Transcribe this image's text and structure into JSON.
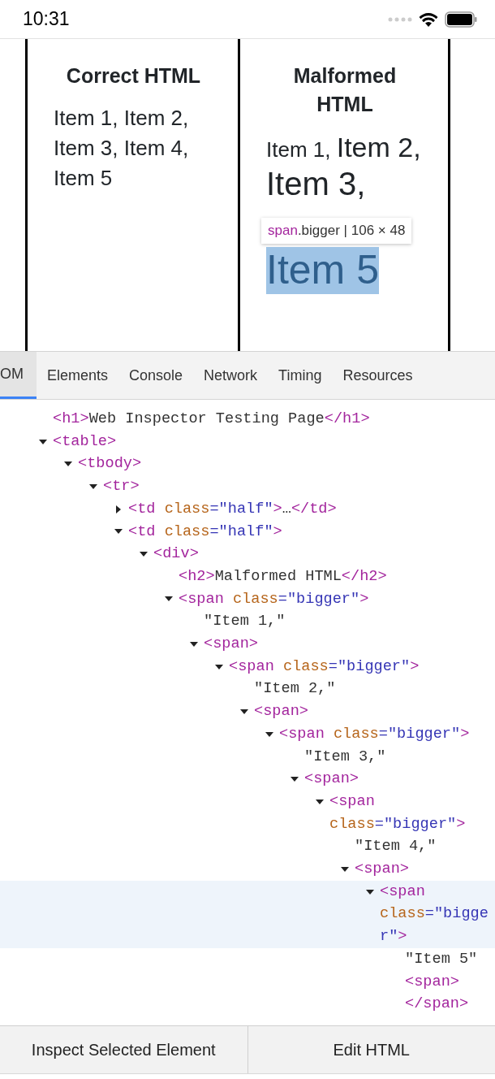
{
  "status_bar": {
    "time": "10:31"
  },
  "preview": {
    "columns": [
      {
        "heading": "Correct HTML",
        "items": [
          {
            "text": "Item 1,",
            "selected": false
          },
          {
            "text": "Item 2,",
            "selected": false
          },
          {
            "text": "Item 3,",
            "selected": false
          },
          {
            "text": "Item 4,",
            "selected": false
          },
          {
            "text": "Item 5",
            "selected": false
          }
        ],
        "kind": "flat"
      },
      {
        "heading": "Malformed HTML",
        "items": [
          {
            "text": "Item 1,",
            "selected": false
          },
          {
            "text": "Item 2,",
            "selected": false
          },
          {
            "text": "Item 3,",
            "selected": false
          },
          {
            "text": "Item 5",
            "selected": true
          }
        ],
        "kind": "nested"
      }
    ],
    "tooltip": {
      "tag": "span",
      "rest": ".bigger | 106 × 48"
    }
  },
  "tabs": [
    {
      "label": "OM",
      "selected": true
    },
    {
      "label": "Elements",
      "selected": false
    },
    {
      "label": "Console",
      "selected": false
    },
    {
      "label": "Network",
      "selected": false
    },
    {
      "label": "Timing",
      "selected": false
    },
    {
      "label": "Resources",
      "selected": false
    }
  ],
  "dom_tree": [
    {
      "selected": false,
      "lines": [
        [
          {
            "kind": "tag",
            "text": "<h1>"
          },
          {
            "kind": "text",
            "text": "Web Inspector Testing Page"
          },
          {
            "kind": "tag",
            "text": "</h1>"
          }
        ]
      ]
    },
    {
      "selected": false,
      "expanded": true,
      "lines": [
        [
          {
            "kind": "tag",
            "text": "<table>"
          }
        ]
      ],
      "children": [
        {
          "selected": false,
          "expanded": true,
          "lines": [
            [
              {
                "kind": "tag",
                "text": "<tbody>"
              }
            ]
          ],
          "children": [
            {
              "selected": false,
              "expanded": true,
              "lines": [
                [
                  {
                    "kind": "tag",
                    "text": "<tr>"
                  }
                ]
              ],
              "children": [
                {
                  "selected": false,
                  "expanded": false,
                  "lines": [
                    [
                      {
                        "kind": "tag",
                        "text": "<td"
                      },
                      {
                        "kind": "attr",
                        "text": " class"
                      },
                      {
                        "kind": "value",
                        "text": "=\"half\""
                      },
                      {
                        "kind": "tag",
                        "text": ">"
                      },
                      {
                        "kind": "text",
                        "text": "…"
                      },
                      {
                        "kind": "tag",
                        "text": "</td>"
                      }
                    ]
                  ]
                },
                {
                  "selected": false,
                  "expanded": true,
                  "lines": [
                    [
                      {
                        "kind": "tag",
                        "text": "<td"
                      },
                      {
                        "kind": "attr",
                        "text": " class"
                      },
                      {
                        "kind": "value",
                        "text": "=\"half\""
                      },
                      {
                        "kind": "tag",
                        "text": ">"
                      }
                    ]
                  ],
                  "children": [
                    {
                      "selected": false,
                      "expanded": true,
                      "lines": [
                        [
                          {
                            "kind": "tag",
                            "text": "<div>"
                          }
                        ]
                      ],
                      "children": [
                        {
                          "selected": false,
                          "lines": [
                            [
                              {
                                "kind": "tag",
                                "text": "<h2>"
                              },
                              {
                                "kind": "text",
                                "text": "Malformed HTML"
                              },
                              {
                                "kind": "tag",
                                "text": "</h2>"
                              }
                            ]
                          ]
                        },
                        {
                          "selected": false,
                          "expanded": true,
                          "lines": [
                            [
                              {
                                "kind": "tag",
                                "text": "<span"
                              },
                              {
                                "kind": "attr",
                                "text": " class"
                              },
                              {
                                "kind": "value",
                                "text": "=\"bigger\""
                              },
                              {
                                "kind": "tag",
                                "text": ">"
                              }
                            ]
                          ],
                          "children": [
                            {
                              "selected": false,
                              "lines": [
                                [
                                  {
                                    "kind": "text",
                                    "text": "\"Item 1,\""
                                  }
                                ]
                              ]
                            },
                            {
                              "selected": false,
                              "expanded": true,
                              "lines": [
                                [
                                  {
                                    "kind": "tag",
                                    "text": "<span>"
                                  }
                                ]
                              ],
                              "children": [
                                {
                                  "selected": false,
                                  "expanded": true,
                                  "lines": [
                                    [
                                      {
                                        "kind": "tag",
                                        "text": "<span"
                                      },
                                      {
                                        "kind": "attr",
                                        "text": " class"
                                      },
                                      {
                                        "kind": "value",
                                        "text": "=\"bigger\""
                                      },
                                      {
                                        "kind": "tag",
                                        "text": ">"
                                      }
                                    ]
                                  ],
                                  "children": [
                                    {
                                      "selected": false,
                                      "lines": [
                                        [
                                          {
                                            "kind": "text",
                                            "text": "\"Item 2,\""
                                          }
                                        ]
                                      ]
                                    },
                                    {
                                      "selected": false,
                                      "expanded": true,
                                      "lines": [
                                        [
                                          {
                                            "kind": "tag",
                                            "text": "<span>"
                                          }
                                        ]
                                      ],
                                      "children": [
                                        {
                                          "selected": false,
                                          "expanded": true,
                                          "lines": [
                                            [
                                              {
                                                "kind": "tag",
                                                "text": "<span"
                                              },
                                              {
                                                "kind": "attr",
                                                "text": " class"
                                              },
                                              {
                                                "kind": "value",
                                                "text": "=\"bigger\""
                                              },
                                              {
                                                "kind": "tag",
                                                "text": ">"
                                              }
                                            ]
                                          ],
                                          "children": [
                                            {
                                              "selected": false,
                                              "lines": [
                                                [
                                                  {
                                                    "kind": "text",
                                                    "text": "\"Item 3,\""
                                                  }
                                                ]
                                              ]
                                            },
                                            {
                                              "selected": false,
                                              "expanded": true,
                                              "lines": [
                                                [
                                                  {
                                                    "kind": "tag",
                                                    "text": "<span>"
                                                  }
                                                ]
                                              ],
                                              "children": [
                                                {
                                                  "selected": false,
                                                  "expanded": true,
                                                  "lines": [
                                                    [
                                                      {
                                                        "kind": "tag",
                                                        "text": "<span"
                                                      }
                                                    ],
                                                    [
                                                      {
                                                        "kind": "attr",
                                                        "text": "class"
                                                      },
                                                      {
                                                        "kind": "value",
                                                        "text": "=\"bigger\""
                                                      },
                                                      {
                                                        "kind": "tag",
                                                        "text": ">"
                                                      }
                                                    ]
                                                  ],
                                                  "children": [
                                                    {
                                                      "selected": false,
                                                      "lines": [
                                                        [
                                                          {
                                                            "kind": "text",
                                                            "text": "\"Item 4,\""
                                                          }
                                                        ]
                                                      ]
                                                    },
                                                    {
                                                      "selected": false,
                                                      "expanded": true,
                                                      "lines": [
                                                        [
                                                          {
                                                            "kind": "tag",
                                                            "text": "<span>"
                                                          }
                                                        ]
                                                      ],
                                                      "children": [
                                                        {
                                                          "selected": true,
                                                          "expanded": true,
                                                          "lines": [
                                                            [
                                                              {
                                                                "kind": "tag",
                                                                "text": "<span"
                                                              }
                                                            ],
                                                            [
                                                              {
                                                                "kind": "attr",
                                                                "text": "class"
                                                              },
                                                              {
                                                                "kind": "value",
                                                                "text": "=\"bigge"
                                                              }
                                                            ],
                                                            [
                                                              {
                                                                "kind": "value",
                                                                "text": "r\""
                                                              },
                                                              {
                                                                "kind": "tag",
                                                                "text": ">"
                                                              }
                                                            ]
                                                          ],
                                                          "children": [
                                                            {
                                                              "selected": false,
                                                              "lines": [
                                                                [
                                                                  {
                                                                    "kind": "text",
                                                                    "text": "\"Item 5\""
                                                                  }
                                                                ]
                                                              ]
                                                            },
                                                            {
                                                              "selected": false,
                                                              "lines": [
                                                                [
                                                                  {
                                                                    "kind": "tag",
                                                                    "text": "<span>"
                                                                  }
                                                                ],
                                                                [
                                                                  {
                                                                    "kind": "tag",
                                                                    "text": "</span>"
                                                                  }
                                                                ]
                                                              ]
                                                            }
                                                          ]
                                                        }
                                                      ]
                                                    }
                                                  ]
                                                }
                                              ]
                                            }
                                          ]
                                        }
                                      ]
                                    }
                                  ]
                                }
                              ]
                            }
                          ]
                        }
                      ]
                    }
                  ]
                }
              ]
            }
          ]
        }
      ]
    }
  ],
  "buttons": [
    {
      "label": "Inspect Selected Element"
    },
    {
      "label": "Edit HTML"
    }
  ]
}
